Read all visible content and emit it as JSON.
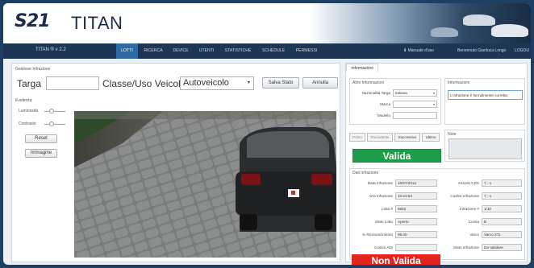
{
  "header": {
    "logo": "S21",
    "product": "TITAN"
  },
  "nav": {
    "brand": "TITAN ® v 2.2",
    "tabs": [
      "LOTTI",
      "RICERCA",
      "DEVICE",
      "UTENTI",
      "STATISTICHE",
      "SCHEDULE",
      "PERMESSI"
    ],
    "active_tab": "LOTTI",
    "manual": "Manuale d'uso",
    "welcome": "Benvenuto Gianluca Longo",
    "logout": "LOGOU"
  },
  "gestione": {
    "title": "Gestione Infrazione",
    "targa_label": "Targa",
    "targa_value": "",
    "classe_label": "Classe/Uso Veicolo",
    "classe_value": "Autoveicolo",
    "save_label": "Salva Stato",
    "cancel_label": "Annulla"
  },
  "evidenza": {
    "title": "Evidenza",
    "luminosita": "Luminosità",
    "contrasto": "Contrasto",
    "reset": "Reset",
    "immagine": "Immagine"
  },
  "info": {
    "tab": "Informazioni",
    "altre_title": "Altre Informazioni",
    "nazionalita_label": "Nazionalità Targa",
    "nazionalita_value": "Italiana",
    "marca_label": "Marca",
    "modello_label": "Modello",
    "informazioni_title": "Informazioni",
    "informazioni_value": "L'infrazione è formalmente corretta.",
    "note_title": "Note",
    "nav_buttons": [
      "Primo",
      "Precedente",
      "Successivo",
      "Ultimo"
    ],
    "valida": "Valida",
    "non_valida": "Non Valida"
  },
  "dati": {
    "title": "Dati Infrazione",
    "left": [
      {
        "label": "Data Infrazione",
        "value": "16/07/2014"
      },
      {
        "label": "Ora infrazione",
        "value": "10:23:54"
      },
      {
        "label": "Lotto #",
        "value": "6652"
      },
      {
        "label": "Stato Lotto",
        "value": "Aperto"
      },
      {
        "label": "% Riconoscimento",
        "value": "99.00"
      },
      {
        "label": "Codice ADI",
        "value": ""
      }
    ],
    "right": [
      {
        "label": "Articolo CDS",
        "value": "7 - 1"
      },
      {
        "label": "Codice Infrazione",
        "value": "7 - 1"
      },
      {
        "label": "Infrazione #",
        "value": "1/10"
      },
      {
        "label": "Corsia",
        "value": "B"
      },
      {
        "label": "Varco",
        "value": "Varco ZTL"
      },
      {
        "label": "Stato Infrazione",
        "value": "Da Validare"
      }
    ]
  }
}
